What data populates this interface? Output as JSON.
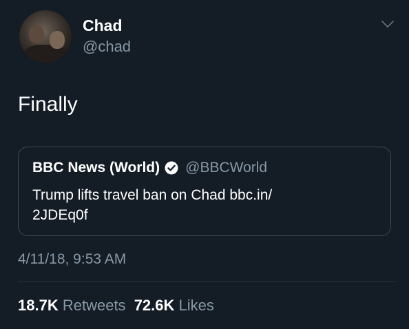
{
  "user": {
    "display_name": "Chad",
    "handle": "@chad"
  },
  "tweet": {
    "text": "Finally",
    "timestamp": "4/11/18, 9:53 AM"
  },
  "quoted_tweet": {
    "display_name": "BBC News (World)",
    "handle": "@BBCWorld",
    "verified": true,
    "text_line1": "Trump lifts travel ban on Chad bbc.in/",
    "text_line2": "2JDEq0f"
  },
  "stats": {
    "retweets_count": "18.7K",
    "retweets_label": "Retweets",
    "likes_count": "72.6K",
    "likes_label": "Likes"
  },
  "icons": {
    "menu": "chevron-down-icon",
    "verified": "verified-badge-icon"
  },
  "colors": {
    "background": "#141c26",
    "secondary_text": "#8899a6",
    "border": "#3d4a57"
  }
}
